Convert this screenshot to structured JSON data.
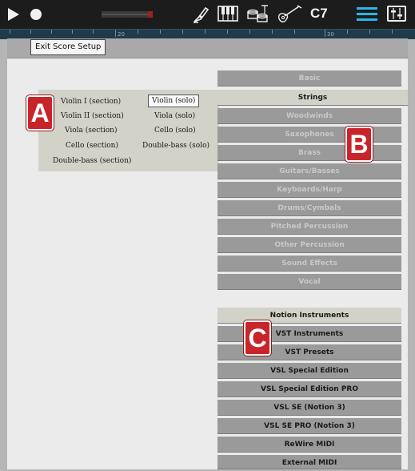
{
  "toolbar": {
    "key_label": "C7",
    "icons": [
      "play-icon",
      "record-icon",
      "level-meter",
      "pen-icon",
      "keyboard-icon",
      "drums-icon",
      "guitar-icon",
      "list-view-icon",
      "mixer-icon"
    ],
    "accent_color": "#2bb6e6"
  },
  "ruler": {
    "marks": [
      "20",
      "30"
    ]
  },
  "subbar": {
    "exit_label": "Exit Score Setup"
  },
  "instruments": {
    "section": [
      "Violin I (section)",
      "Violin II (section)",
      "Viola (section)",
      "Cello (section)",
      "Double-bass (section)"
    ],
    "solo": [
      "Violin (solo)",
      "Viola (solo)",
      "Cello (solo)",
      "Double-bass (solo)"
    ],
    "selected": "Violin (solo)"
  },
  "categories": {
    "items": [
      "Basic",
      "Strings",
      "Woodwinds",
      "Saxophones",
      "Brass",
      "Guitars/Basses",
      "Keyboards/Harp",
      "Drums/Cymbals",
      "Pitched Percussion",
      "Other Percussion",
      "Sound Effects",
      "Vocal"
    ],
    "selected": "Strings"
  },
  "sources": {
    "items": [
      "Notion Instruments",
      "VST Instruments",
      "VST Presets",
      "VSL Special Edition",
      "VSL Special Edition PRO",
      "VSL SE (Notion 3)",
      "VSL SE PRO (Notion 3)",
      "ReWire MIDI",
      "External MIDI"
    ],
    "selected": "Notion Instruments"
  },
  "badges": {
    "a": "A",
    "b": "B",
    "c": "C"
  },
  "badge_color": "#c8252a"
}
